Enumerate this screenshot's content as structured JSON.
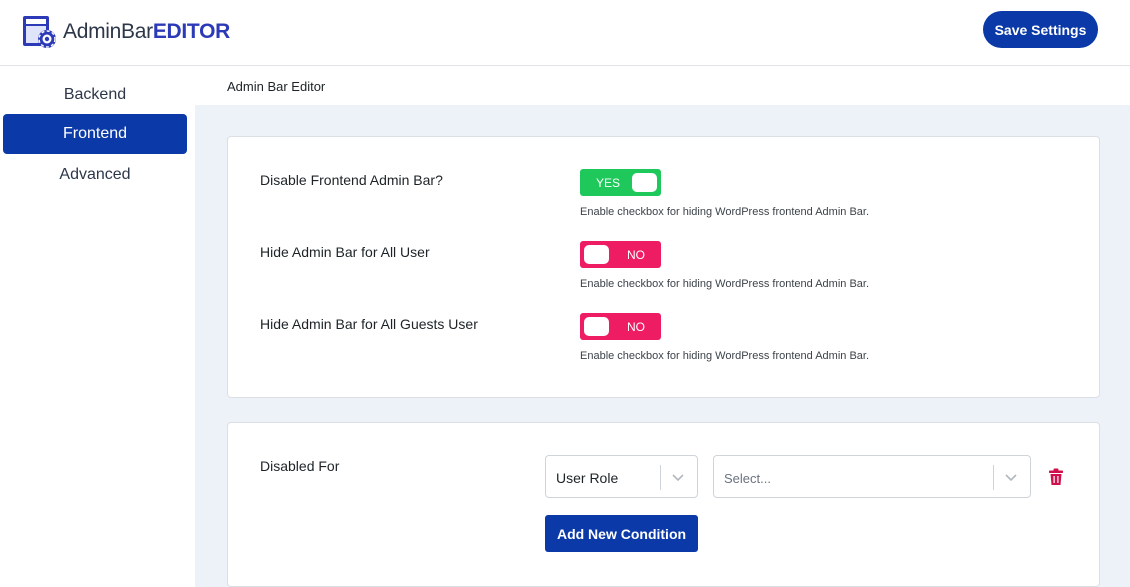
{
  "header": {
    "logo_text_light": "AdminBar",
    "logo_text_bold": "EDITOR",
    "save_label": "Save Settings"
  },
  "sidebar": {
    "items": [
      {
        "label": "Backend",
        "active": false
      },
      {
        "label": "Frontend",
        "active": true
      },
      {
        "label": "Advanced",
        "active": false
      }
    ]
  },
  "breadcrumb": "Admin Bar Editor",
  "settings": [
    {
      "label": "Disable Frontend Admin Bar?",
      "toggle": "YES",
      "state": "on",
      "help": "Enable checkbox for hiding WordPress frontend Admin Bar."
    },
    {
      "label": "Hide Admin Bar for All User",
      "toggle": "NO",
      "state": "off",
      "help": "Enable checkbox for hiding WordPress frontend Admin Bar."
    },
    {
      "label": "Hide Admin Bar for All Guests User",
      "toggle": "NO",
      "state": "off",
      "help": "Enable checkbox for hiding WordPress frontend Admin Bar."
    }
  ],
  "conditions": {
    "label": "Disabled For",
    "type_value": "User Role",
    "value_placeholder": "Select...",
    "add_label": "Add New Condition"
  },
  "colors": {
    "primary": "#0b3aa8",
    "toggle_on": "#1ec85b",
    "toggle_off": "#ee1d63",
    "trash": "#d0104c"
  },
  "icons": {
    "logo": "admin-bar-gear-icon",
    "chevron": "chevron-down-icon",
    "trash": "trash-icon"
  }
}
